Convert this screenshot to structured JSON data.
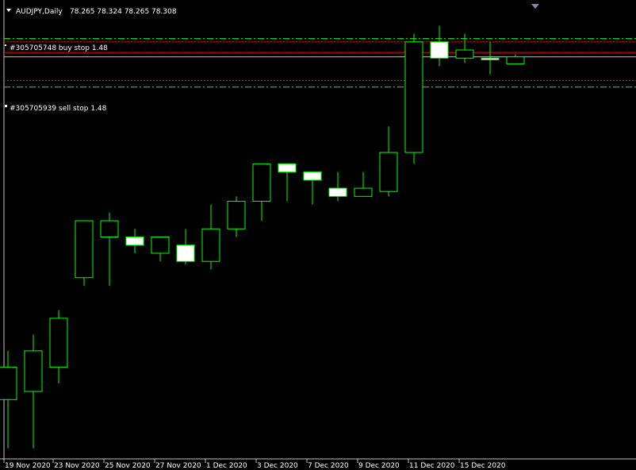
{
  "header": {
    "symbol_label": "AUDJPY,Daily",
    "ohlc_text": "78.265 78.324 78.265 78.308"
  },
  "orders": [
    {
      "label": "#305705748 buy stop 1.48"
    },
    {
      "label": "#305705939 sell stop 1.48"
    }
  ],
  "date_labels": [
    "19 Nov 2020",
    "23 Nov 2020",
    "25 Nov 2020",
    "27 Nov 2020",
    "1 Dec 2020",
    "3 Dec 2020",
    "7 Dec 2020",
    "9 Dec 2020",
    "11 Dec 2020",
    "15 Dec 2020"
  ],
  "colors": {
    "background": "#000000",
    "grid_line": "#c0c0c0",
    "bull_fill": "#000000",
    "bear_fill": "#ffffff",
    "candle_stroke": "#00ff00",
    "order_line": "#ff0000",
    "stop_dash": "#00ff00",
    "price_line": "#c0c0c0"
  },
  "chart_data": {
    "type": "candlestick",
    "title": "AUDJPY,Daily",
    "candles": [
      {
        "open": 76.2,
        "high": 76.5,
        "low": 75.9,
        "close": 76.4
      },
      {
        "open": 76.25,
        "high": 76.6,
        "low": 75.9,
        "close": 76.5
      },
      {
        "open": 76.4,
        "high": 76.75,
        "low": 76.3,
        "close": 76.7
      },
      {
        "open": 76.95,
        "high": 77.3,
        "low": 76.9,
        "close": 77.3
      },
      {
        "open": 77.2,
        "high": 77.35,
        "low": 76.9,
        "close": 77.3
      },
      {
        "open": 77.2,
        "high": 77.25,
        "low": 77.1,
        "close": 77.15
      },
      {
        "open": 77.1,
        "high": 77.2,
        "low": 77.05,
        "close": 77.2
      },
      {
        "open": 77.15,
        "high": 77.25,
        "low": 77.03,
        "close": 77.05
      },
      {
        "open": 77.05,
        "high": 77.4,
        "low": 77.0,
        "close": 77.25
      },
      {
        "open": 77.25,
        "high": 77.45,
        "low": 77.2,
        "close": 77.42
      },
      {
        "open": 77.42,
        "high": 77.55,
        "low": 77.3,
        "close": 77.65
      },
      {
        "open": 77.65,
        "high": 77.65,
        "low": 77.42,
        "close": 77.6
      },
      {
        "open": 77.6,
        "high": 77.6,
        "low": 77.4,
        "close": 77.55
      },
      {
        "open": 77.5,
        "high": 77.6,
        "low": 77.42,
        "close": 77.45
      },
      {
        "open": 77.45,
        "high": 77.6,
        "low": 77.45,
        "close": 77.5
      },
      {
        "open": 77.48,
        "high": 77.88,
        "low": 77.45,
        "close": 77.72
      },
      {
        "open": 77.72,
        "high": 78.45,
        "low": 77.65,
        "close": 78.4
      },
      {
        "open": 78.4,
        "high": 78.5,
        "low": 78.25,
        "close": 78.3
      },
      {
        "open": 78.3,
        "high": 78.45,
        "low": 78.27,
        "close": 78.35
      },
      {
        "open": 78.3,
        "high": 78.4,
        "low": 78.2,
        "close": 78.29
      },
      {
        "open": 78.265,
        "high": 78.324,
        "low": 78.265,
        "close": 78.308
      }
    ],
    "order_levels": [
      78.4,
      78.33
    ],
    "buy_stop_level": 78.42,
    "sell_stop_level": 78.22,
    "current_price": 78.308,
    "ylim": [
      75.85,
      78.56
    ],
    "grid": false
  }
}
